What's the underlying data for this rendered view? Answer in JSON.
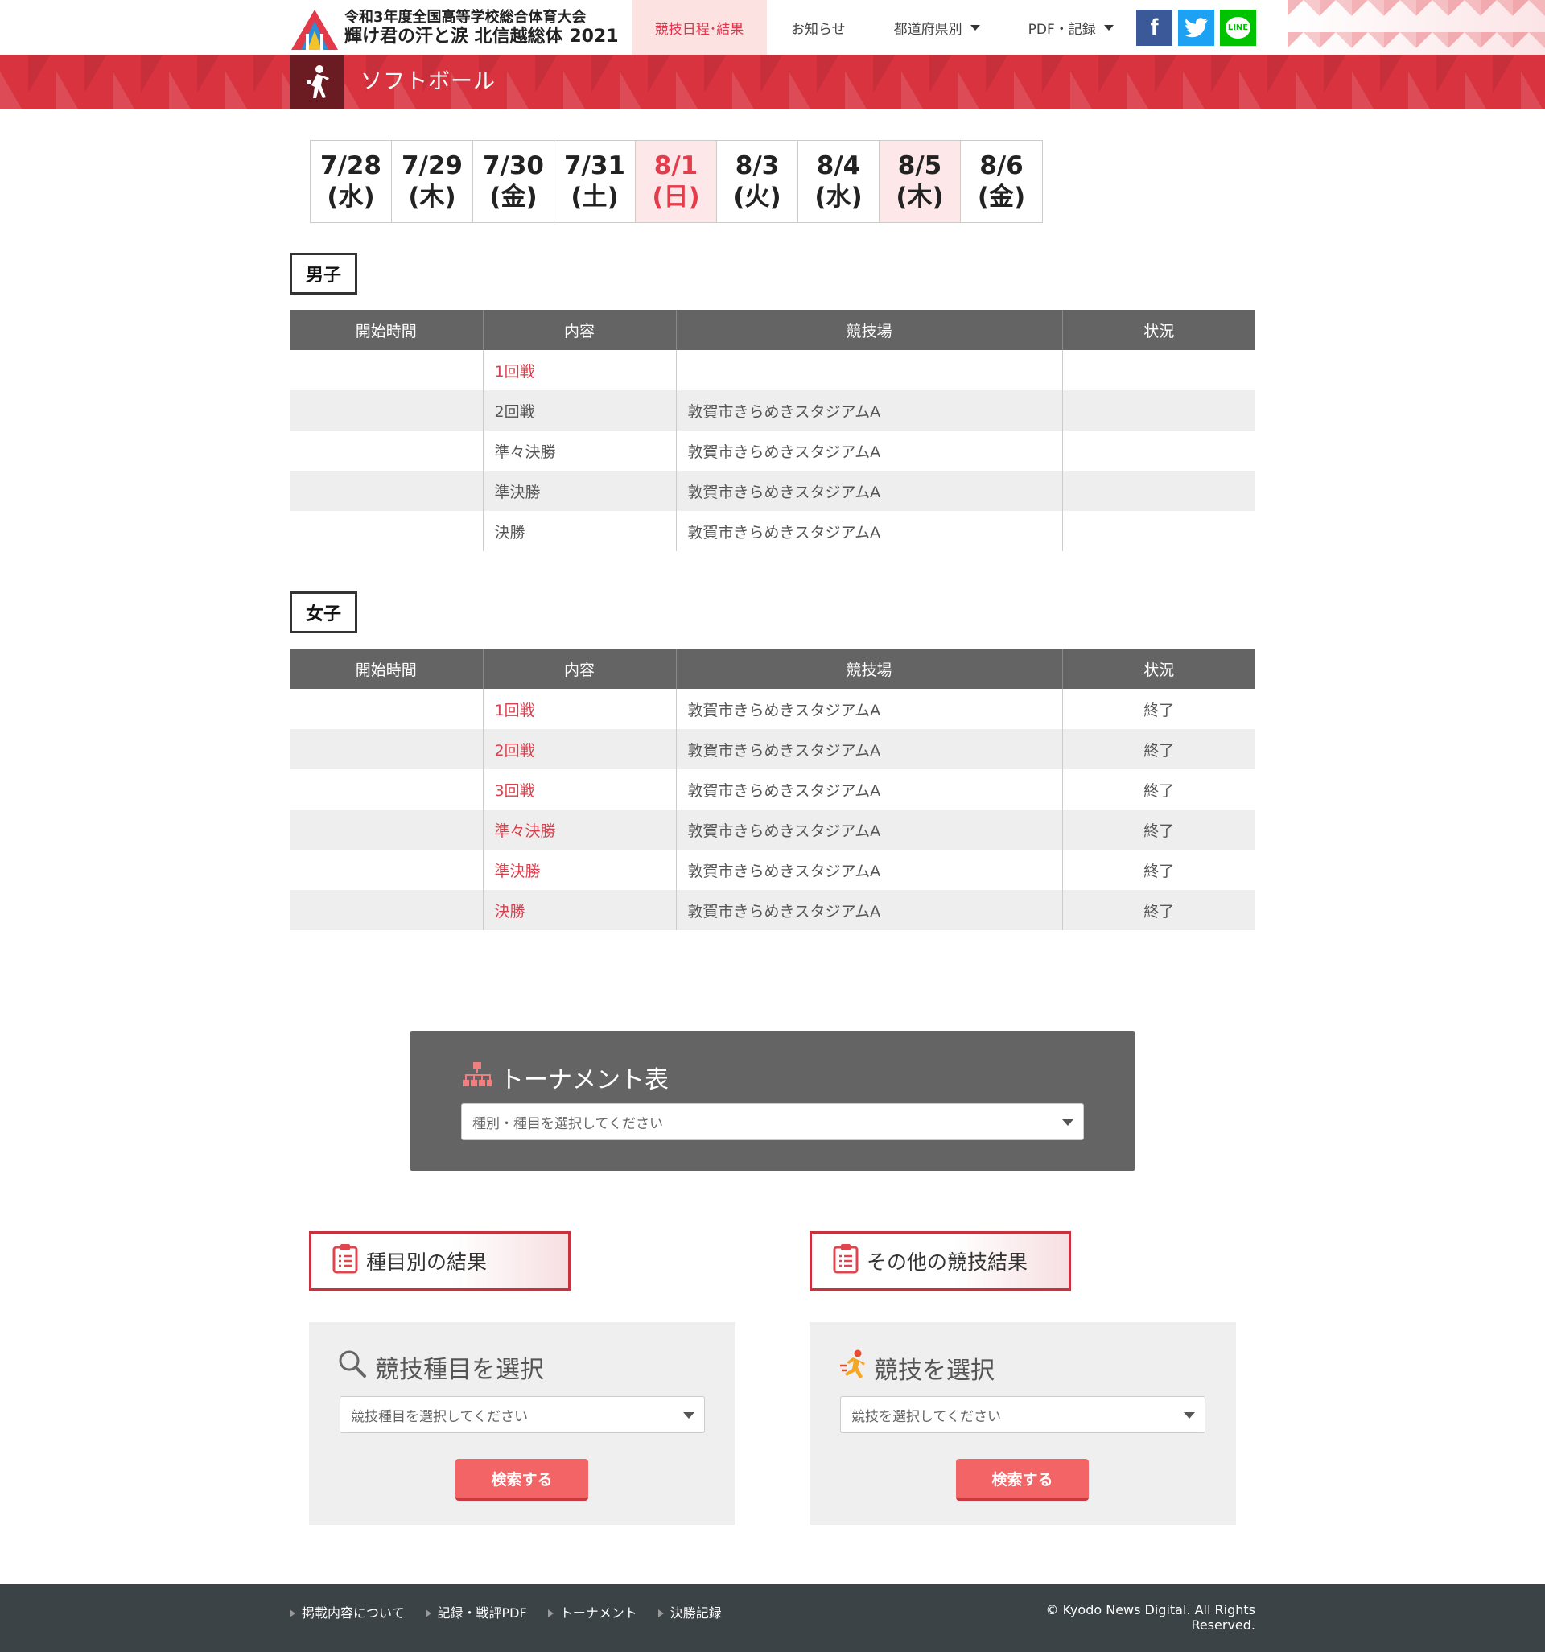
{
  "header": {
    "logo_line1": "令和3年度全国高等学校総合体育大会",
    "logo_line2": "輝け君の汗と涙 北信越総体 2021",
    "logo_year": "2021",
    "nav": [
      {
        "label": "競技日程･結果"
      },
      {
        "label": "お知らせ"
      },
      {
        "label": "都道府県別"
      },
      {
        "label": "PDF・記録"
      }
    ],
    "social": {
      "facebook": "f",
      "line": "LINE"
    }
  },
  "banner": {
    "title": "ソフトボール"
  },
  "dates": [
    {
      "date": "7/28",
      "dow": "(水)"
    },
    {
      "date": "7/29",
      "dow": "(木)"
    },
    {
      "date": "7/30",
      "dow": "(金)"
    },
    {
      "date": "7/31",
      "dow": "(土)"
    },
    {
      "date": "8/1",
      "dow": "(日)"
    },
    {
      "date": "8/3",
      "dow": "(火)"
    },
    {
      "date": "8/4",
      "dow": "(水)"
    },
    {
      "date": "8/5",
      "dow": "(木)"
    },
    {
      "date": "8/6",
      "dow": "(金)"
    }
  ],
  "table_headers": [
    "開始時間",
    "内容",
    "競技場",
    "状況"
  ],
  "men": {
    "label": "男子",
    "rows": [
      {
        "time": "",
        "content": "1回戦",
        "venue": "",
        "status": "",
        "link": true
      },
      {
        "time": "",
        "content": "2回戦",
        "venue": "敦賀市きらめきスタジアムA",
        "status": "",
        "link": false
      },
      {
        "time": "",
        "content": "準々決勝",
        "venue": "敦賀市きらめきスタジアムA",
        "status": "",
        "link": false
      },
      {
        "time": "",
        "content": "準決勝",
        "venue": "敦賀市きらめきスタジアムA",
        "status": "",
        "link": false
      },
      {
        "time": "",
        "content": "決勝",
        "venue": "敦賀市きらめきスタジアムA",
        "status": "",
        "link": false
      }
    ]
  },
  "women": {
    "label": "女子",
    "rows": [
      {
        "time": "",
        "content": "1回戦",
        "venue": "敦賀市きらめきスタジアムA",
        "status": "終了",
        "link": true
      },
      {
        "time": "",
        "content": "2回戦",
        "venue": "敦賀市きらめきスタジアムA",
        "status": "終了",
        "link": true
      },
      {
        "time": "",
        "content": "3回戦",
        "venue": "敦賀市きらめきスタジアムA",
        "status": "終了",
        "link": true
      },
      {
        "time": "",
        "content": "準々決勝",
        "venue": "敦賀市きらめきスタジアムA",
        "status": "終了",
        "link": true
      },
      {
        "time": "",
        "content": "準決勝",
        "venue": "敦賀市きらめきスタジアムA",
        "status": "終了",
        "link": true
      },
      {
        "time": "",
        "content": "決勝",
        "venue": "敦賀市きらめきスタジアムA",
        "status": "終了",
        "link": true
      }
    ]
  },
  "tournament": {
    "title": "トーナメント表",
    "placeholder": "種別・種目を選択してください"
  },
  "results": {
    "by_event": "種目別の結果",
    "other": "その他の競技結果"
  },
  "panels": {
    "event": {
      "title": "競技種目を選択",
      "placeholder": "競技種目を選択してください",
      "button": "検索する"
    },
    "sport": {
      "title": "競技を選択",
      "placeholder": "競技を選択してください",
      "button": "検索する"
    }
  },
  "footer": {
    "links": [
      "掲載内容について",
      "記録・戦評PDF",
      "トーナメント",
      "決勝記録"
    ],
    "copyright": "© Kyodo News Digital. All Rights Reserved."
  },
  "colors": {
    "accent": "#e33c4b",
    "banner": "#d8333f",
    "table_head": "#646464",
    "button": "#f26466",
    "footer": "#3b4347"
  }
}
